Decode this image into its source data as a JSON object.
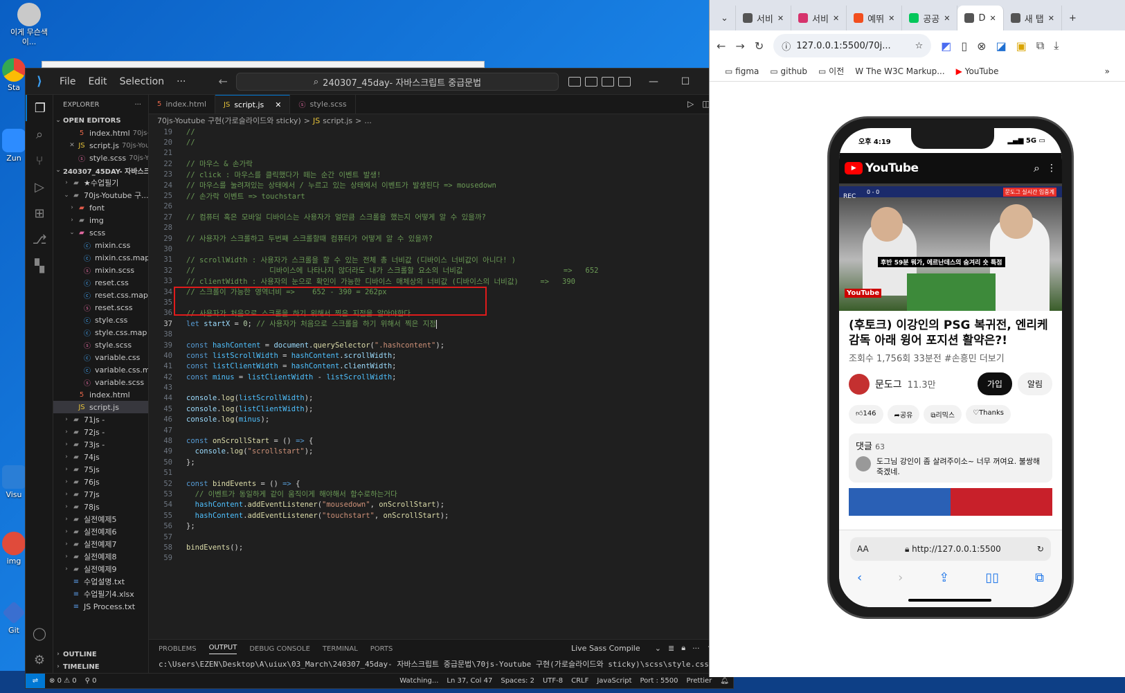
{
  "desktop": {
    "icons": [
      {
        "label": "이게 무슨색이..."
      },
      {
        "label": "Sta"
      },
      {
        "label": "Zun"
      },
      {
        "label": "Visu"
      },
      {
        "label": "img"
      },
      {
        "label": "Git"
      }
    ]
  },
  "vscode": {
    "menu": [
      "File",
      "Edit",
      "Selection"
    ],
    "search": "240307_45day- 자바스크립트 중급문법",
    "explorer_title": "EXPLORER",
    "open_editors_title": "OPEN EDITORS",
    "open_editors": [
      {
        "name": "index.html",
        "dim": "70js-Y..."
      },
      {
        "name": "script.js",
        "dim": "70js-You..."
      },
      {
        "name": "style.scss",
        "dim": "70js-Yo..."
      }
    ],
    "workspace": "240307_45DAY- 자바스크림...",
    "tree": [
      {
        "label": "★수업필기",
        "indent": 1,
        "kind": "folder",
        "open": false
      },
      {
        "label": "70js-Youtube 구...",
        "indent": 1,
        "kind": "folder",
        "open": true
      },
      {
        "label": "font",
        "indent": 2,
        "kind": "folder-red",
        "open": false
      },
      {
        "label": "img",
        "indent": 2,
        "kind": "folder",
        "open": false
      },
      {
        "label": "scss",
        "indent": 2,
        "kind": "folder-sass",
        "open": true
      },
      {
        "label": "mixin.css",
        "indent": 3,
        "kind": "css"
      },
      {
        "label": "mixin.css.map",
        "indent": 3,
        "kind": "css"
      },
      {
        "label": "mixin.scss",
        "indent": 3,
        "kind": "scss"
      },
      {
        "label": "reset.css",
        "indent": 3,
        "kind": "css"
      },
      {
        "label": "reset.css.map",
        "indent": 3,
        "kind": "css"
      },
      {
        "label": "reset.scss",
        "indent": 3,
        "kind": "scss"
      },
      {
        "label": "style.css",
        "indent": 3,
        "kind": "css"
      },
      {
        "label": "style.css.map",
        "indent": 3,
        "kind": "css"
      },
      {
        "label": "style.scss",
        "indent": 3,
        "kind": "scss"
      },
      {
        "label": "variable.css",
        "indent": 3,
        "kind": "css"
      },
      {
        "label": "variable.css.map",
        "indent": 3,
        "kind": "css"
      },
      {
        "label": "variable.scss",
        "indent": 3,
        "kind": "scss"
      },
      {
        "label": "index.html",
        "indent": 2,
        "kind": "html"
      },
      {
        "label": "script.js",
        "indent": 2,
        "kind": "js",
        "selected": true
      },
      {
        "label": "71js -",
        "indent": 1,
        "kind": "folder",
        "open": false
      },
      {
        "label": "72js -",
        "indent": 1,
        "kind": "folder",
        "open": false
      },
      {
        "label": "73js -",
        "indent": 1,
        "kind": "folder",
        "open": false
      },
      {
        "label": "74js",
        "indent": 1,
        "kind": "folder",
        "open": false
      },
      {
        "label": "75js",
        "indent": 1,
        "kind": "folder",
        "open": false
      },
      {
        "label": "76js",
        "indent": 1,
        "kind": "folder",
        "open": false
      },
      {
        "label": "77js",
        "indent": 1,
        "kind": "folder",
        "open": false
      },
      {
        "label": "78js",
        "indent": 1,
        "kind": "folder",
        "open": false
      },
      {
        "label": "실전예제5",
        "indent": 1,
        "kind": "folder",
        "open": false
      },
      {
        "label": "실전예제6",
        "indent": 1,
        "kind": "folder",
        "open": false
      },
      {
        "label": "실전예제7",
        "indent": 1,
        "kind": "folder",
        "open": false
      },
      {
        "label": "실전예제8",
        "indent": 1,
        "kind": "folder",
        "open": false
      },
      {
        "label": "실전예제9",
        "indent": 1,
        "kind": "folder",
        "open": false
      },
      {
        "label": "수업설명.txt",
        "indent": 1,
        "kind": "txt"
      },
      {
        "label": "수업필기4.xlsx",
        "indent": 1,
        "kind": "xlsx"
      },
      {
        "label": "JS Process.txt",
        "indent": 1,
        "kind": "txt"
      }
    ],
    "outline": "OUTLINE",
    "timeline": "TIMELINE",
    "tabs": [
      {
        "label": "index.html"
      },
      {
        "label": "script.js",
        "active": true
      },
      {
        "label": "style.scss"
      }
    ],
    "breadcrumb": [
      "70js-Youtube 구현(가로슬라이드와 sticky)",
      ">",
      "script.js",
      ">",
      "..."
    ],
    "code": [
      {
        "n": "19",
        "t": [
          [
            "c",
            "//"
          ]
        ]
      },
      {
        "n": "20",
        "t": [
          [
            "c",
            "//"
          ]
        ]
      },
      {
        "n": "21",
        "t": []
      },
      {
        "n": "22",
        "t": [
          [
            "c",
            "// 마우스 & 손가락"
          ]
        ]
      },
      {
        "n": "23",
        "t": [
          [
            "c",
            "// click : 마우스를 클릭했다가 떼는 순간 이벤트 발생!"
          ]
        ]
      },
      {
        "n": "24",
        "t": [
          [
            "c",
            "// 마우스를 눌려져있는 상태에서 / 누르고 있는 상태에서 이벤트가 발생된다 => mousedown"
          ]
        ]
      },
      {
        "n": "25",
        "t": [
          [
            "c",
            "// 손가락 이벤트 => touchstart"
          ]
        ]
      },
      {
        "n": "26",
        "t": []
      },
      {
        "n": "27",
        "t": [
          [
            "c",
            "// 컴퓨터 혹은 모바일 디바이스는 사용자가 얼만큼 스크롤을 했는지 어떻게 알 수 있을까?"
          ]
        ]
      },
      {
        "n": "28",
        "t": []
      },
      {
        "n": "29",
        "t": [
          [
            "c",
            "// 사용자가 스크롤하고 두번째 스크롤할때 컴퓨터가 어떻게 알 수 있을까?"
          ]
        ]
      },
      {
        "n": "30",
        "t": []
      },
      {
        "n": "31",
        "t": [
          [
            "c",
            "// scrollWidth : 사용자가 스크롤을 할 수 있는 전체 총 너비값 (디바이스 너비값이 아니다! )"
          ]
        ]
      },
      {
        "n": "32",
        "t": [
          [
            "c",
            "//                 디바이스에 나타나지 않더라도 내가 스크롤할 요소의 너비값                       =>   652"
          ]
        ]
      },
      {
        "n": "33",
        "t": [
          [
            "c",
            "// clientWidth : 사용자의 눈으로 확인이 가능한 디바이스 매체상의 너비값 (디바이스의 너비값)     =>   390"
          ]
        ]
      },
      {
        "n": "34",
        "t": [
          [
            "c",
            "// 스크롤이 가능한 영역너비 =>    652 - 390 = 262px"
          ]
        ]
      },
      {
        "n": "35",
        "t": []
      },
      {
        "n": "36",
        "t": [
          [
            "c",
            "// 사용자가 처음으로 스크롤을 하기 위해서 찍은 지점을 알아야한다"
          ]
        ]
      },
      {
        "n": "37",
        "t": [
          [
            "k",
            "let "
          ],
          [
            "v",
            "startX"
          ],
          [
            "p",
            " = "
          ],
          [
            "n",
            "0"
          ],
          [
            "p",
            "; "
          ],
          [
            "c",
            "// 사용자가 처음으로 스크롤을 하기 위해서 찍은 지점"
          ]
        ],
        "cur": true
      },
      {
        "n": "38",
        "t": []
      },
      {
        "n": "39",
        "t": [
          [
            "k",
            "const "
          ],
          [
            "ck",
            "hashContent"
          ],
          [
            "p",
            " = "
          ],
          [
            "v",
            "document"
          ],
          [
            "p",
            "."
          ],
          [
            "f",
            "querySelector"
          ],
          [
            "p",
            "("
          ],
          [
            "s",
            "\".hashcontent\""
          ],
          [
            "p",
            ");"
          ]
        ]
      },
      {
        "n": "40",
        "t": [
          [
            "k",
            "const "
          ],
          [
            "ck",
            "listScrollWidth"
          ],
          [
            "p",
            " = "
          ],
          [
            "ck",
            "hashContent"
          ],
          [
            "p",
            "."
          ],
          [
            "v",
            "scrollWidth"
          ],
          [
            "p",
            ";"
          ]
        ]
      },
      {
        "n": "41",
        "t": [
          [
            "k",
            "const "
          ],
          [
            "ck",
            "listClientWidth"
          ],
          [
            "p",
            " = "
          ],
          [
            "ck",
            "hashContent"
          ],
          [
            "p",
            "."
          ],
          [
            "v",
            "clientWidth"
          ],
          [
            "p",
            ";"
          ]
        ]
      },
      {
        "n": "42",
        "t": [
          [
            "k",
            "const "
          ],
          [
            "ck",
            "minus"
          ],
          [
            "p",
            " = "
          ],
          [
            "ck",
            "listClientWidth"
          ],
          [
            "p",
            " - "
          ],
          [
            "ck",
            "listScrollWidth"
          ],
          [
            "p",
            ";"
          ]
        ]
      },
      {
        "n": "43",
        "t": []
      },
      {
        "n": "44",
        "t": [
          [
            "v",
            "console"
          ],
          [
            "p",
            "."
          ],
          [
            "f",
            "log"
          ],
          [
            "p",
            "("
          ],
          [
            "ck",
            "listScrollWidth"
          ],
          [
            "p",
            ");"
          ]
        ]
      },
      {
        "n": "45",
        "t": [
          [
            "v",
            "console"
          ],
          [
            "p",
            "."
          ],
          [
            "f",
            "log"
          ],
          [
            "p",
            "("
          ],
          [
            "ck",
            "listClientWidth"
          ],
          [
            "p",
            ");"
          ]
        ]
      },
      {
        "n": "46",
        "t": [
          [
            "v",
            "console"
          ],
          [
            "p",
            "."
          ],
          [
            "f",
            "log"
          ],
          [
            "p",
            "("
          ],
          [
            "ck",
            "minus"
          ],
          [
            "p",
            ");"
          ]
        ]
      },
      {
        "n": "47",
        "t": []
      },
      {
        "n": "48",
        "t": [
          [
            "k",
            "const "
          ],
          [
            "f",
            "onScrollStart"
          ],
          [
            "p",
            " = () "
          ],
          [
            "k",
            "=>"
          ],
          [
            "p",
            " {"
          ]
        ]
      },
      {
        "n": "49",
        "t": [
          [
            "p",
            "  "
          ],
          [
            "v",
            "console"
          ],
          [
            "p",
            "."
          ],
          [
            "f",
            "log"
          ],
          [
            "p",
            "("
          ],
          [
            "s",
            "\"scrollstart\""
          ],
          [
            "p",
            ");"
          ]
        ]
      },
      {
        "n": "50",
        "t": [
          [
            "p",
            "};"
          ]
        ]
      },
      {
        "n": "51",
        "t": []
      },
      {
        "n": "52",
        "t": [
          [
            "k",
            "const "
          ],
          [
            "f",
            "bindEvents"
          ],
          [
            "p",
            " = () "
          ],
          [
            "k",
            "=>"
          ],
          [
            "p",
            " {"
          ]
        ]
      },
      {
        "n": "53",
        "t": [
          [
            "p",
            "  "
          ],
          [
            "c",
            "// 이벤트가 동일하게 같이 움직이게 해야해서 함수로하는거다"
          ]
        ]
      },
      {
        "n": "54",
        "t": [
          [
            "p",
            "  "
          ],
          [
            "ck",
            "hashContent"
          ],
          [
            "p",
            "."
          ],
          [
            "f",
            "addEventListener"
          ],
          [
            "p",
            "("
          ],
          [
            "s",
            "\"mousedown\""
          ],
          [
            "p",
            ", "
          ],
          [
            "f",
            "onScrollStart"
          ],
          [
            "p",
            ");"
          ]
        ]
      },
      {
        "n": "55",
        "t": [
          [
            "p",
            "  "
          ],
          [
            "ck",
            "hashContent"
          ],
          [
            "p",
            "."
          ],
          [
            "f",
            "addEventListener"
          ],
          [
            "p",
            "("
          ],
          [
            "s",
            "\"touchstart\""
          ],
          [
            "p",
            ", "
          ],
          [
            "f",
            "onScrollStart"
          ],
          [
            "p",
            ");"
          ]
        ]
      },
      {
        "n": "56",
        "t": [
          [
            "p",
            "};"
          ]
        ]
      },
      {
        "n": "57",
        "t": []
      },
      {
        "n": "58",
        "t": [
          [
            "f",
            "bindEvents"
          ],
          [
            "p",
            "();"
          ]
        ]
      },
      {
        "n": "59",
        "t": []
      }
    ],
    "panel_tabs": [
      "PROBLEMS",
      "OUTPUT",
      "DEBUG CONSOLE",
      "TERMINAL",
      "PORTS"
    ],
    "panel_active": "OUTPUT",
    "output_channel": "Live Sass Compile",
    "output_text": "c:\\Users\\EZEN\\Desktop\\A\\uiux\\03_March\\240307_45day- 자바스크립트 중급문법\\70js-Youtube 구현(가로슬라이드와 sticky)\\scss\\style.css",
    "status": {
      "errors": "0",
      "warnings": "0",
      "ports": "0",
      "watching": "Watching...",
      "position": "Ln 37, Col 47",
      "spaces": "Spaces: 2",
      "encoding": "UTF-8",
      "eol": "CRLF",
      "lang": "JavaScript",
      "port": "Port : 5500",
      "prettier": "Prettier"
    }
  },
  "chrome": {
    "tabs": [
      {
        "label": "서비",
        "color": "#555"
      },
      {
        "label": "서비",
        "color": "#d6336c"
      },
      {
        "label": "예뛰",
        "color": "#f24e1e"
      },
      {
        "label": "공공",
        "color": "#03c75a"
      },
      {
        "label": "D",
        "color": "#555",
        "active": true
      },
      {
        "label": "새 탭",
        "color": "#555"
      }
    ],
    "url": "127.0.0.1:5500/70j...",
    "bookmarks": [
      "figma",
      "github",
      "이전",
      "The W3C Markup...",
      "YouTube"
    ]
  },
  "phone": {
    "time": "오후 4:19",
    "signal": "5G",
    "yt_logo": "YouTube",
    "thumb": {
      "rec": "REC",
      "caption": "후반 59분 뭐가, 에르난데스의 숨겨리 숏 특점",
      "badge": "문도그 실시간 입중계",
      "score": "0 - 0",
      "wm": "YouTube"
    },
    "title": "(후토크) 이강인의 PSG 복귀전, 엔리케 감독 아래 윙어 포지션 활약은?!",
    "meta": "조회수 1,756회  33분전  #손흥민  더보기",
    "channel": "문도그",
    "subs": "11.3만",
    "join": "가입",
    "notify": "알림",
    "actions": [
      "146",
      "공유",
      "리믹스",
      "Thanks"
    ],
    "comments_label": "댓글",
    "comments_count": "63",
    "comment": "도그님 강인이 좀 살려주이소~ 너무 꺼여요. 불쌍해죽겠네.",
    "safari_url": "http://127.0.0.1:5500",
    "aa": "AA"
  }
}
